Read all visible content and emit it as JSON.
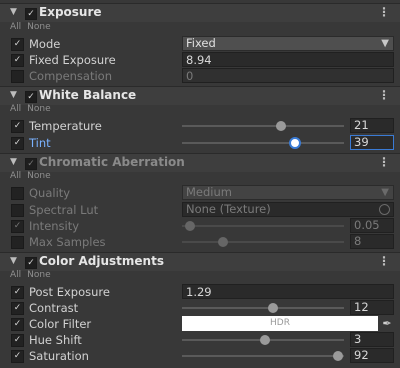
{
  "common": {
    "all": "All",
    "none": "None",
    "menu": "⋮",
    "check": "✓",
    "arrow": "▼"
  },
  "exposure": {
    "title": "Exposure",
    "mode": {
      "label": "Mode",
      "value": "Fixed"
    },
    "fixed_exposure": {
      "label": "Fixed Exposure",
      "value": "8.94"
    },
    "compensation": {
      "label": "Compensation",
      "value": "0"
    }
  },
  "white_balance": {
    "title": "White Balance",
    "temperature": {
      "label": "Temperature",
      "value": "21",
      "level": 0.61
    },
    "tint": {
      "label": "Tint",
      "value": "39",
      "level": 0.7
    }
  },
  "chromatic_aberration": {
    "title": "Chromatic Aberration",
    "quality": {
      "label": "Quality",
      "value": "Medium"
    },
    "spectral_lut": {
      "label": "Spectral Lut",
      "value": "None (Texture)"
    },
    "intensity": {
      "label": "Intensity",
      "value": "0.05",
      "level": 0.05
    },
    "max_samples": {
      "label": "Max Samples",
      "value": "8",
      "level": 0.25
    }
  },
  "color_adjustments": {
    "title": "Color Adjustments",
    "post_exposure": {
      "label": "Post Exposure",
      "value": "1.29"
    },
    "contrast": {
      "label": "Contrast",
      "value": "12",
      "level": 0.56
    },
    "color_filter": {
      "label": "Color Filter",
      "value": "HDR",
      "color": "#ffffff"
    },
    "hue_shift": {
      "label": "Hue Shift",
      "value": "3",
      "level": 0.51
    },
    "saturation": {
      "label": "Saturation",
      "value": "92",
      "level": 0.96
    }
  }
}
